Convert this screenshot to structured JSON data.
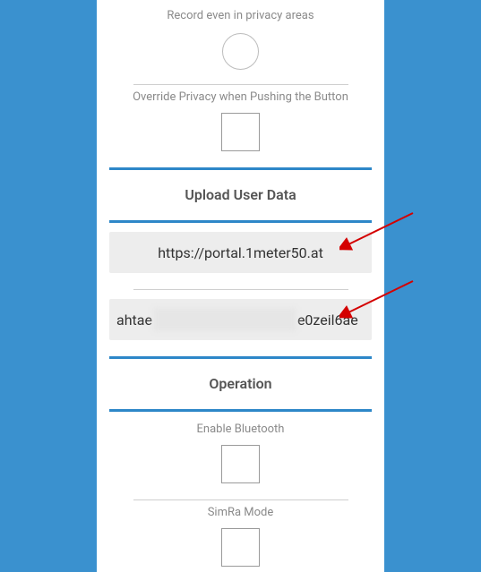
{
  "settings": {
    "record_privacy_label": "Record even in privacy areas",
    "override_privacy_label": "Override Privacy when Pushing the Button"
  },
  "upload": {
    "heading": "Upload User Data",
    "url": "https://portal.1meter50.at",
    "hash_prefix": "ahtae",
    "hash_suffix": "e0zeil6ae"
  },
  "operation": {
    "heading": "Operation",
    "bluetooth_label": "Enable Bluetooth",
    "simra_label": "SimRa Mode"
  }
}
